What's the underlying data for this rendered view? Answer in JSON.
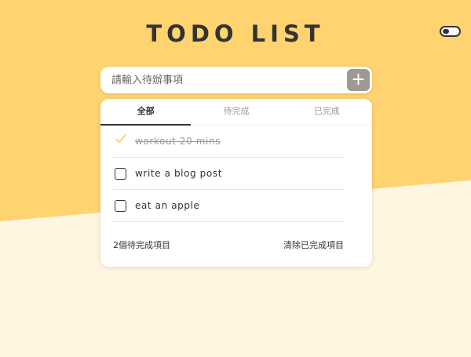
{
  "header": {
    "title": "TODO LIST"
  },
  "theme_toggle": {
    "icon": "toggle-switch-icon"
  },
  "input": {
    "placeholder": "請輸入待辦事項",
    "value": "",
    "add_label": "+"
  },
  "tabs": [
    {
      "label": "全部",
      "active": true
    },
    {
      "label": "待完成",
      "active": false
    },
    {
      "label": "已完成",
      "active": false
    }
  ],
  "todos": [
    {
      "text": "workout 20 mins",
      "done": true
    },
    {
      "text": "write a blog post",
      "done": false
    },
    {
      "text": "eat an apple",
      "done": false
    }
  ],
  "footer": {
    "pending_count": "2個待完成項目",
    "clear_label": "清除已完成項目"
  },
  "colors": {
    "accent": "#FFD370",
    "background": "#FEF6E1",
    "text": "#333333",
    "muted": "#9F9A91"
  }
}
